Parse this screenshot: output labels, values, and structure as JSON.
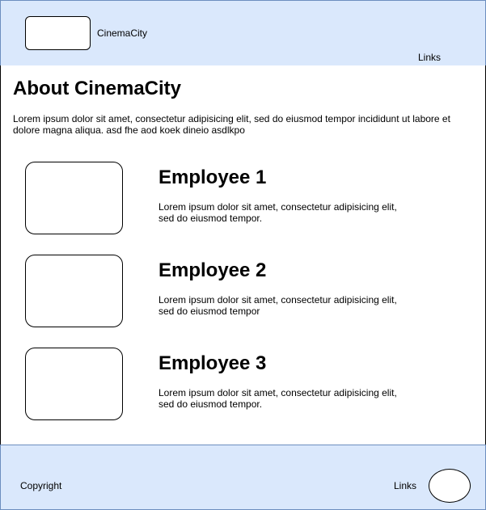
{
  "header": {
    "site_name": "CinemaCity",
    "links_label": "Links"
  },
  "about": {
    "title": "About CinemaCity",
    "description": "Lorem ipsum dolor sit amet, consectetur adipisicing elit, sed do eiusmod tempor incididunt ut labore et dolore magna aliqua. asd fhe aod koek dineio asdlkpo"
  },
  "employees": [
    {
      "name": "Employee 1",
      "description": "Lorem ipsum dolor sit amet, consectetur adipisicing elit, sed do eiusmod tempor."
    },
    {
      "name": "Employee 2",
      "description": "Lorem ipsum dolor sit amet, consectetur adipisicing elit, sed do eiusmod tempor"
    },
    {
      "name": "Employee 3",
      "description": "Lorem ipsum dolor sit amet, consectetur adipisicing elit, sed do eiusmod tempor."
    }
  ],
  "footer": {
    "copyright": "Copyright",
    "links_label": "Links"
  },
  "colors": {
    "header_footer_bg": "#dae8fc",
    "header_footer_border": "#6c8ebf"
  }
}
